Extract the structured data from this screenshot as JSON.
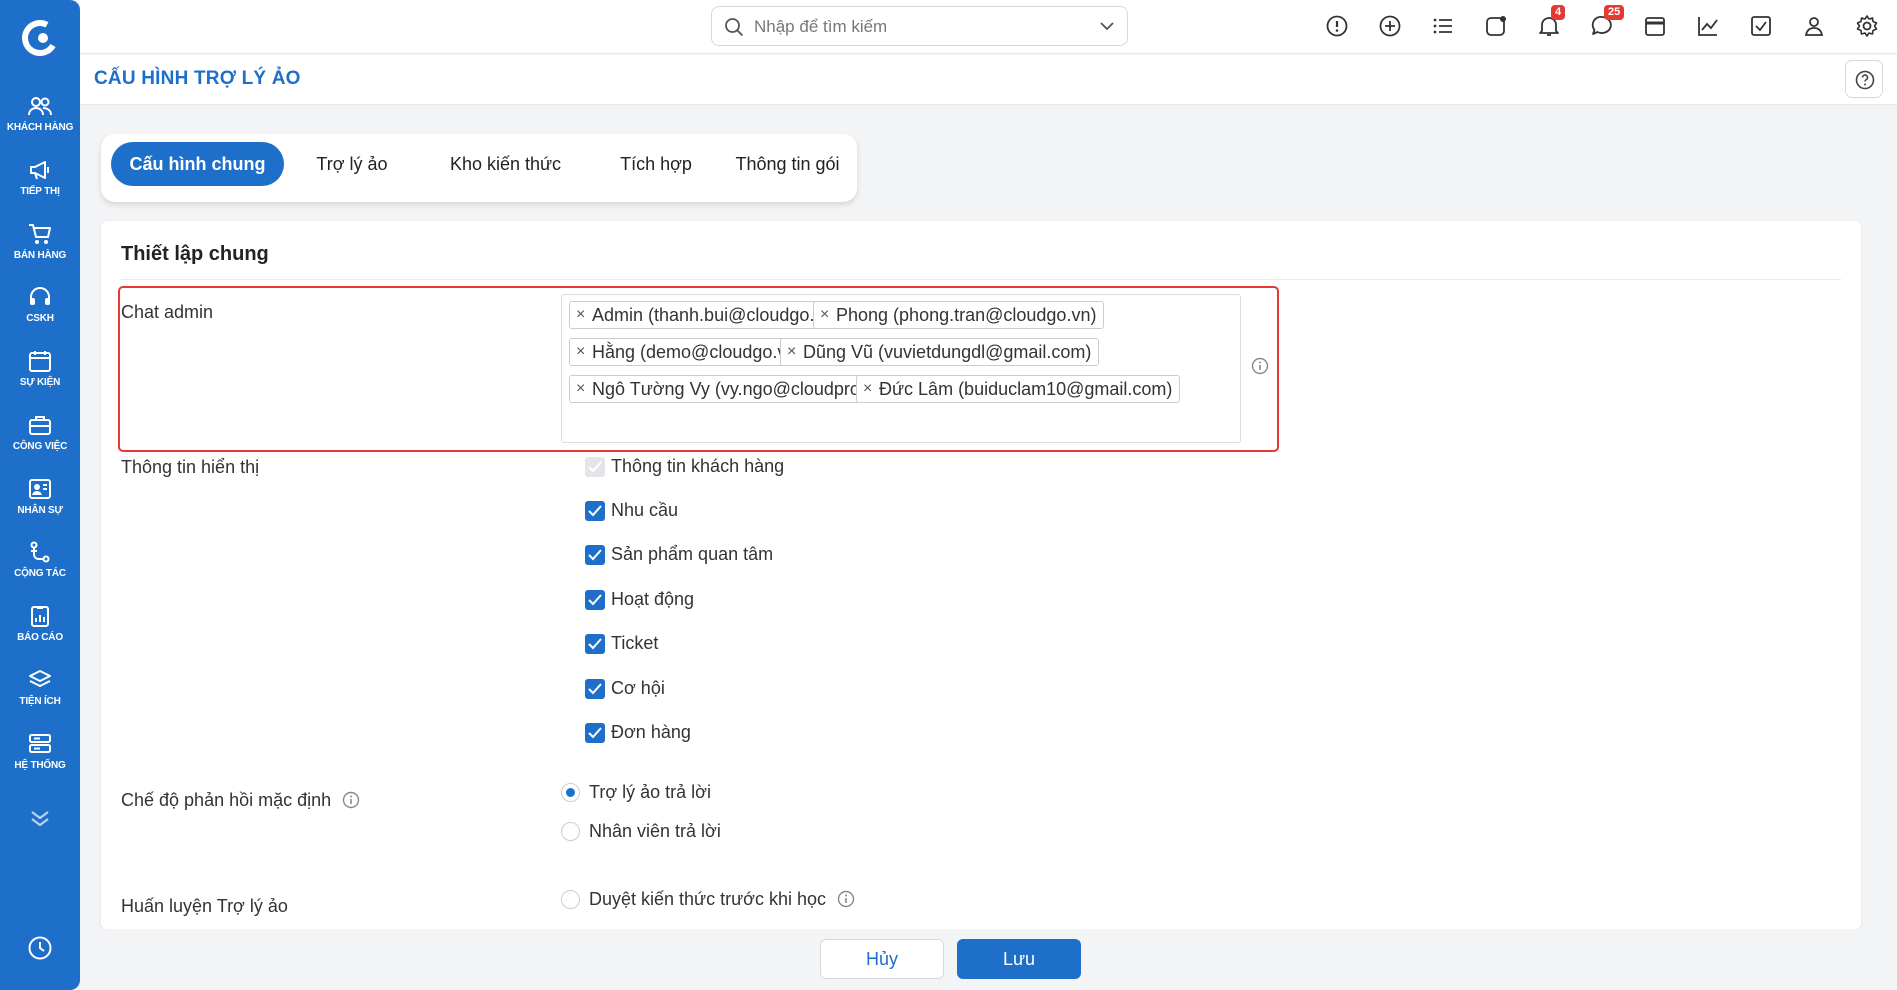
{
  "search": {
    "placeholder": "Nhập để tìm kiếm"
  },
  "topbar": {
    "notification_count": "4",
    "message_count": "25"
  },
  "sidebar": {
    "items": [
      {
        "label": "KHÁCH HÀNG",
        "icon": "users-icon"
      },
      {
        "label": "TIẾP THỊ",
        "icon": "megaphone-icon"
      },
      {
        "label": "BÁN HÀNG",
        "icon": "cart-icon"
      },
      {
        "label": "CSKH",
        "icon": "headset-icon"
      },
      {
        "label": "SỰ KIỆN",
        "icon": "calendar-icon"
      },
      {
        "label": "CÔNG VIỆC",
        "icon": "briefcase-icon"
      },
      {
        "label": "NHÂN SỰ",
        "icon": "id-card-icon"
      },
      {
        "label": "CỘNG TÁC",
        "icon": "collaboration-icon"
      },
      {
        "label": "BÁO CÁO",
        "icon": "report-icon"
      },
      {
        "label": "TIỆN ÍCH",
        "icon": "layers-icon"
      },
      {
        "label": "HỆ THỐNG",
        "icon": "server-icon"
      }
    ]
  },
  "page": {
    "title": "CẤU HÌNH TRỢ LÝ ẢO"
  },
  "tabs": [
    "Cấu hình chung",
    "Trợ lý ảo",
    "Kho kiến thức",
    "Tích hợp",
    "Thông tin gói"
  ],
  "section": {
    "title": "Thiết lập chung"
  },
  "chat_admin": {
    "label": "Chat admin",
    "tags": [
      "Admin (thanh.bui@cloudgo.vn)",
      "Phong (phong.tran@cloudgo.vn)",
      "Hằng (demo@cloudgo.vn)",
      "Dũng Vũ (vuvietdungdl@gmail.com)",
      "Ngô Tường Vy (vy.ngo@cloudpro.vn)",
      "Đức Lâm (buiduclam10@gmail.com)"
    ]
  },
  "display_info": {
    "label": "Thông tin hiển thị",
    "options": [
      {
        "label": "Thông tin khách hàng",
        "checked": true,
        "disabled": true
      },
      {
        "label": "Nhu cầu",
        "checked": true
      },
      {
        "label": "Sản phẩm quan tâm",
        "checked": true
      },
      {
        "label": "Hoạt động",
        "checked": true
      },
      {
        "label": "Ticket",
        "checked": true
      },
      {
        "label": "Cơ hội",
        "checked": true
      },
      {
        "label": "Đơn hàng",
        "checked": true
      }
    ]
  },
  "reply_mode": {
    "label": "Chế độ phản hồi mặc định",
    "options": [
      {
        "label": "Trợ lý ảo trả lời",
        "selected": true
      },
      {
        "label": "Nhân viên trả lời",
        "selected": false
      }
    ]
  },
  "training": {
    "label": "Huấn luyện Trợ lý ảo",
    "option": "Duyệt kiến thức trước khi học"
  },
  "footer": {
    "cancel_label": "Hủy",
    "save_label": "Lưu"
  },
  "colors": {
    "brand": "#1e6fc9",
    "highlight": "#e53935"
  }
}
